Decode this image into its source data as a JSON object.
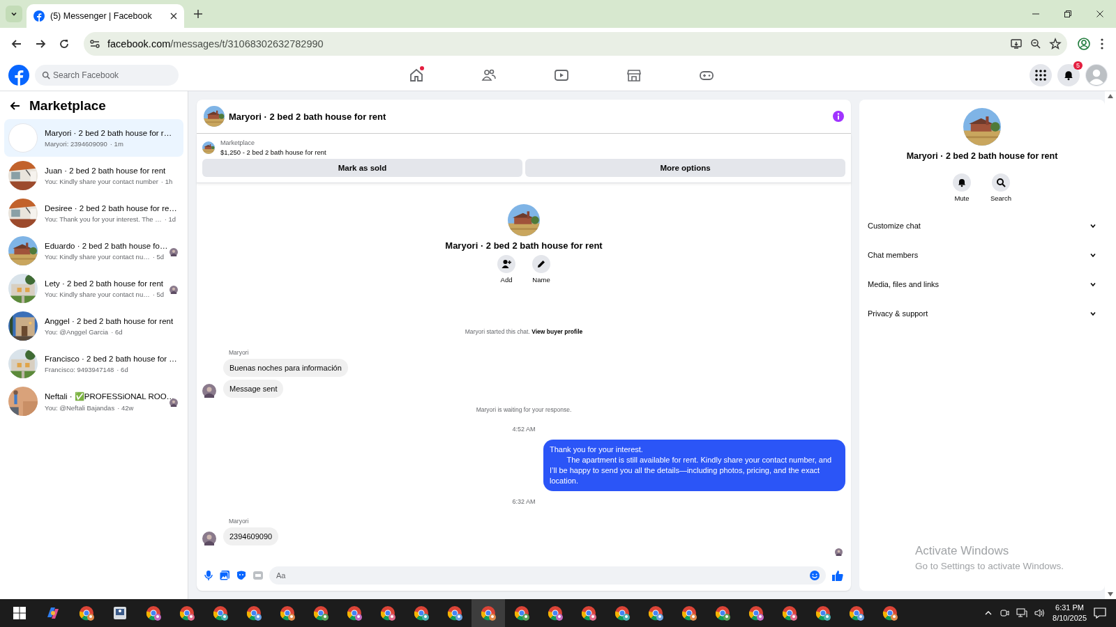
{
  "browser": {
    "tab": {
      "title": "(5) Messenger | Facebook",
      "selected": true
    },
    "url": "facebook.com/messages/t/31068302632782990"
  },
  "top_nav": {
    "search": {
      "placeholder": "Search Facebook"
    },
    "notifications_badge": "5",
    "tabs": [
      {
        "kind": "home",
        "selected": false,
        "dot": true
      },
      {
        "kind": "friends",
        "selected": false,
        "dot": false
      },
      {
        "kind": "video",
        "selected": false,
        "dot": false
      },
      {
        "kind": "marketplace",
        "selected": false,
        "dot": false
      },
      {
        "kind": "gaming",
        "selected": false,
        "dot": false
      }
    ]
  },
  "sidebar": {
    "title": "Marketplace",
    "conversations": [
      {
        "title": "Maryori · 2 bed 2 bath house for r…",
        "preview": "Maryori: 2394609090",
        "time": "· 1m",
        "selected": true,
        "avatar": {
          "kind": "empty"
        },
        "seen": false
      },
      {
        "title": "Juan · 2 bed 2 bath house for rent",
        "preview": "You: Kindly share your contact number",
        "time": "· 1h",
        "selected": false,
        "seen": false
      },
      {
        "title": "Desiree · 2 bed 2 bath house for re…",
        "preview": "You: Thank you for your interest. The …",
        "time": "· 1d",
        "selected": false,
        "seen": false
      },
      {
        "title": "Eduardo · 2 bed 2 bath house fo…",
        "preview": "You: Kindly share your contact nu…",
        "time": "· 5d",
        "selected": false,
        "seen": true
      },
      {
        "title": "Lety · 2 bed 2 bath house for rent",
        "preview": "You: Kindly share your contact nu…",
        "time": "· 5d",
        "selected": false,
        "seen": true
      },
      {
        "title": "Anggel · 2 bed 2 bath house for rent",
        "preview": "You: @Anggel Garcia",
        "time": "· 6d",
        "selected": false,
        "seen": false
      },
      {
        "title": "Francisco · 2 bed 2 bath house for …",
        "preview": "Francisco: 9493947148",
        "time": "· 6d",
        "selected": false,
        "seen": false
      },
      {
        "title": "Neftali · ✅PROFESSiONAL ROO…",
        "preview": "You: @Neftali Bajandas",
        "time": "· 42w",
        "selected": false,
        "seen": true
      }
    ]
  },
  "chat": {
    "title": "Maryori · 2 bed 2 bath house for rent",
    "listing": {
      "label": "Marketplace",
      "item": "$1,250 - 2 bed 2 bath house for rent",
      "buttons": [
        "Mark as sold",
        "More options"
      ]
    },
    "intro": {
      "title": "Maryori · 2 bed 2 bath house for rent",
      "actions": [
        {
          "kind": "add",
          "label": "Add"
        },
        {
          "kind": "name",
          "label": "Name"
        }
      ]
    },
    "messages": [
      {
        "kind": "system",
        "text": "Maryori started this chat.",
        "link": "View buyer profile"
      },
      {
        "kind": "sender",
        "text": "Maryori"
      },
      {
        "kind": "incoming",
        "text": "Buenas noches para información",
        "avatar": false
      },
      {
        "kind": "incoming",
        "text": "Message sent",
        "avatar": true
      },
      {
        "kind": "system",
        "text": "Maryori is waiting for your response."
      },
      {
        "kind": "time",
        "text": "4:52 AM"
      },
      {
        "kind": "outgoing",
        "text": "Thank you for your interest.\n        The apartment is still available for rent. Kindly share your contact number, and I’ll be happy to send you all the details—including photos, pricing, and the exact location."
      },
      {
        "kind": "time",
        "text": "6:32 AM"
      },
      {
        "kind": "sender",
        "text": "Maryori"
      },
      {
        "kind": "incoming",
        "text": "2394609090",
        "avatar": true
      }
    ],
    "seen": true,
    "composer": {
      "placeholder": "Aa"
    }
  },
  "details": {
    "title": "Maryori · 2 bed 2 bath house for rent",
    "actions": [
      {
        "kind": "mute",
        "label": "Mute"
      },
      {
        "kind": "search",
        "label": "Search"
      }
    ],
    "sections": [
      {
        "label": "Customize chat",
        "expanded": false
      },
      {
        "label": "Chat members",
        "expanded": false
      },
      {
        "label": "Media, files and links",
        "expanded": false
      },
      {
        "label": "Privacy & support",
        "expanded": false
      }
    ]
  },
  "activation_notice": {
    "title": "Activate Windows",
    "text": "Go to Settings to activate Windows."
  },
  "taskbar": {
    "apps": [
      {
        "kind": "copilot",
        "selected": false
      },
      {
        "kind": "chrome",
        "selected": false
      },
      {
        "kind": "viewer",
        "selected": false
      },
      {
        "kind": "chrome",
        "selected": false
      },
      {
        "kind": "chrome",
        "selected": false
      },
      {
        "kind": "chrome",
        "selected": false
      },
      {
        "kind": "chrome",
        "selected": false
      },
      {
        "kind": "chrome",
        "selected": false
      },
      {
        "kind": "chrome",
        "selected": false
      },
      {
        "kind": "chrome",
        "selected": false
      },
      {
        "kind": "chrome",
        "selected": false
      },
      {
        "kind": "chrome",
        "selected": false
      },
      {
        "kind": "chrome",
        "selected": false
      },
      {
        "kind": "chrome",
        "selected": true
      },
      {
        "kind": "chrome",
        "selected": false
      },
      {
        "kind": "chrome",
        "selected": false
      },
      {
        "kind": "chrome",
        "selected": false
      },
      {
        "kind": "chrome",
        "selected": false
      },
      {
        "kind": "chrome",
        "selected": false
      },
      {
        "kind": "chrome",
        "selected": false
      },
      {
        "kind": "chrome",
        "selected": false
      },
      {
        "kind": "chrome",
        "selected": false
      },
      {
        "kind": "chrome",
        "selected": false
      },
      {
        "kind": "chrome",
        "selected": false
      },
      {
        "kind": "chrome",
        "selected": false
      },
      {
        "kind": "chrome",
        "selected": false
      }
    ],
    "time": "6:31 PM",
    "date": "8/10/2025"
  }
}
